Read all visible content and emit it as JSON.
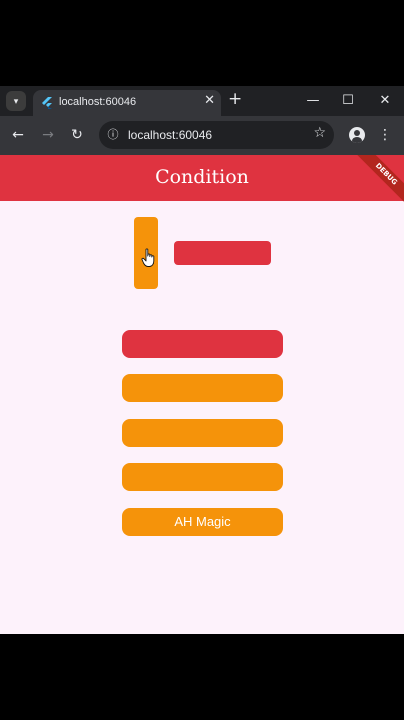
{
  "browser": {
    "tab_title": "localhost:60046",
    "url": "localhost:60046",
    "icons": {
      "tab_search": "chevron-down-icon",
      "tab_close": "close-icon",
      "new_tab": "plus-icon",
      "minimize": "minimize-icon",
      "maximize": "maximize-icon",
      "close_window": "close-icon",
      "back": "arrow-left-icon",
      "forward": "arrow-right-icon",
      "reload": "reload-icon",
      "site_info": "site-info-icon",
      "bookmark": "star-icon",
      "profile": "profile-icon",
      "menu": "kebab-menu-icon"
    }
  },
  "app": {
    "title": "Condition",
    "debug_label": "DEBUG",
    "colors": {
      "primary_red": "#df3340",
      "accent_orange": "#f5930a",
      "background": "#fdf2fb"
    },
    "buttons": [
      {
        "label": "",
        "color": "#df3340"
      },
      {
        "label": "",
        "color": "#f5930a"
      },
      {
        "label": "",
        "color": "#f5930a"
      },
      {
        "label": "",
        "color": "#f5930a"
      },
      {
        "label": "AH Magic",
        "color": "#f5930a"
      }
    ]
  }
}
